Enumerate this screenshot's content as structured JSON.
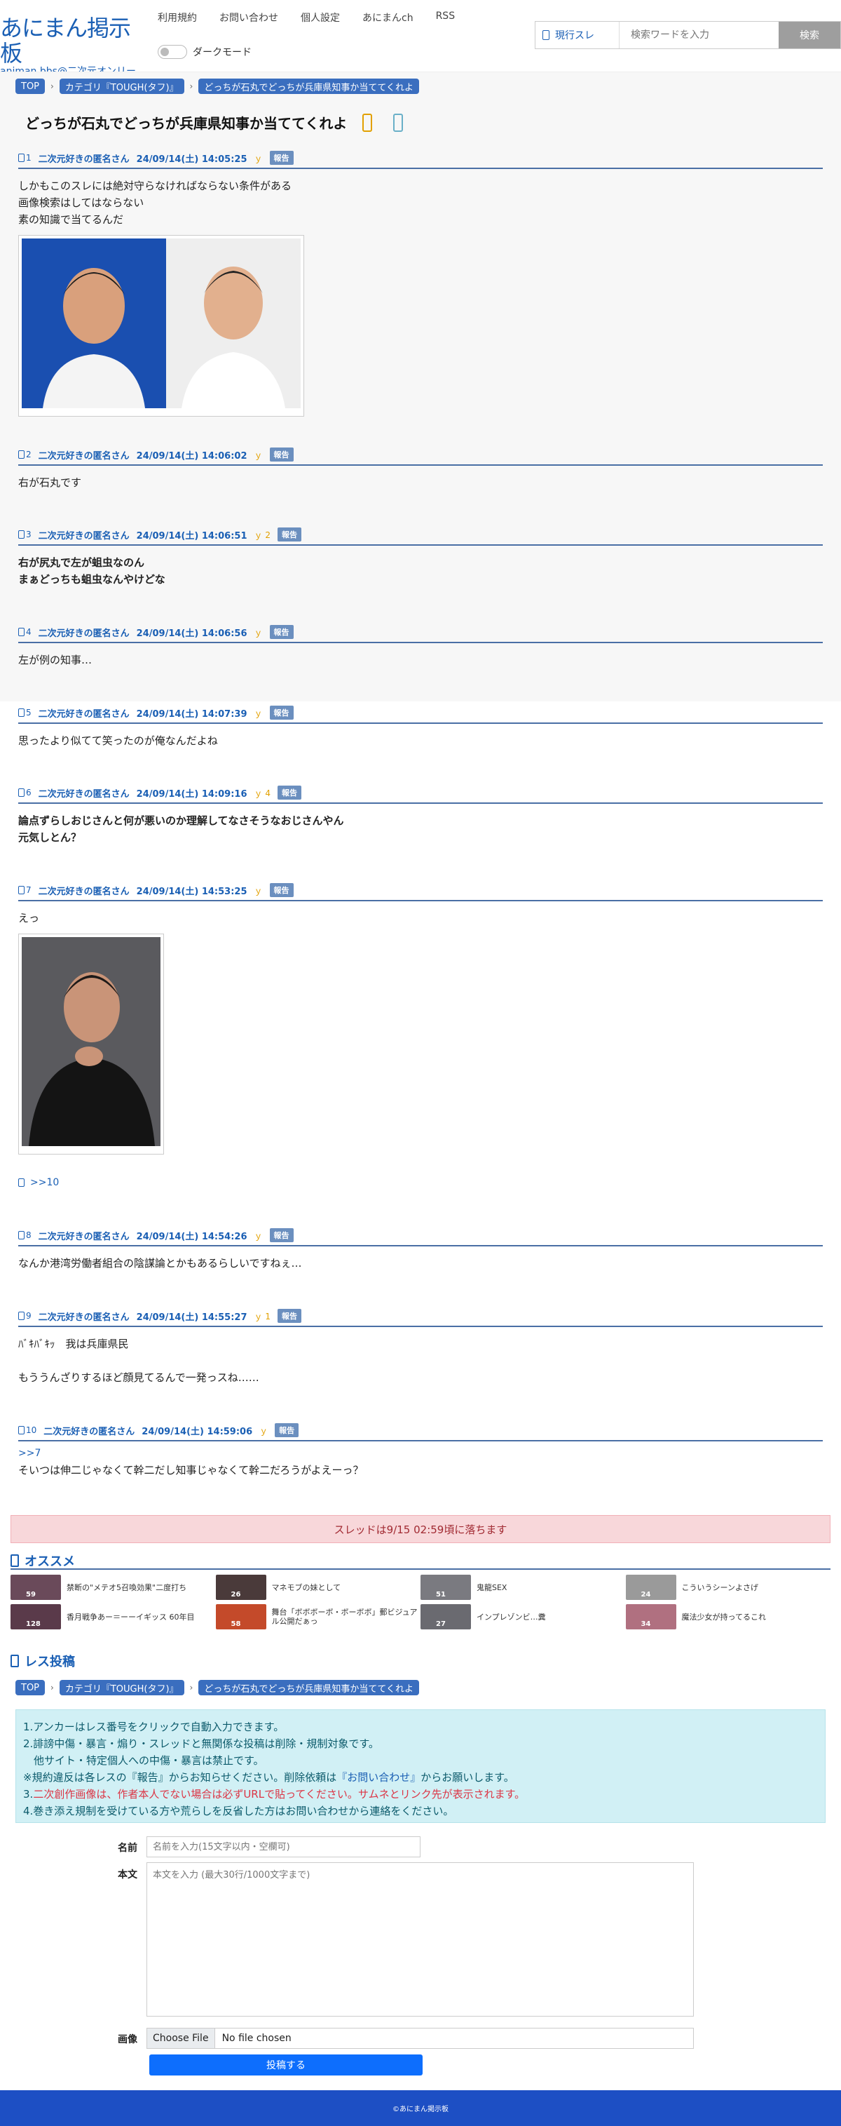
{
  "header": {
    "logo_main": "あにまん掲示板",
    "logo_sub": "animan bbs@二次元オンリー",
    "nav": [
      "利用規約",
      "お問い合わせ",
      "個人設定",
      "あにまんch",
      "RSS"
    ],
    "darkmode_label": "ダークモード",
    "search": {
      "scope": "現行スレ",
      "placeholder": "検索ワードを入力",
      "button": "検索"
    }
  },
  "breadcrumb": {
    "top": "TOP",
    "category": "カテゴリ『TOUGH(タフ)』",
    "thread": "どっちが石丸でどっちが兵庫県知事か当ててくれよ"
  },
  "thread": {
    "title": "どっちが石丸でどっちが兵庫県知事か当ててくれよ"
  },
  "posts": [
    {
      "num": "1",
      "name": "二次元好きの匿名さん",
      "date": "24/09/14(土) 14:05:25",
      "good": "",
      "report": "報告",
      "lines": [
        "しかもこのスレには絶対守らなければならない条件がある",
        "画像検索はしてはならない",
        "素の知識で当てるんだ"
      ]
    },
    {
      "num": "2",
      "name": "二次元好きの匿名さん",
      "date": "24/09/14(土) 14:06:02",
      "good": "",
      "report": "報告",
      "lines": [
        "右が石丸です"
      ]
    },
    {
      "num": "3",
      "name": "二次元好きの匿名さん",
      "date": "24/09/14(土) 14:06:51",
      "good": "2",
      "report": "報告",
      "lines": [
        "右が尻丸で左が蛆虫なのん",
        "まぁどっちも蛆虫なんやけどな"
      ]
    },
    {
      "num": "4",
      "name": "二次元好きの匿名さん",
      "date": "24/09/14(土) 14:06:56",
      "good": "",
      "report": "報告",
      "lines": [
        "左が例の知事…"
      ]
    },
    {
      "num": "5",
      "name": "二次元好きの匿名さん",
      "date": "24/09/14(土) 14:07:39",
      "good": "",
      "report": "報告",
      "lines": [
        "思ったより似てて笑ったのが俺なんだよね"
      ]
    },
    {
      "num": "6",
      "name": "二次元好きの匿名さん",
      "date": "24/09/14(土) 14:09:16",
      "good": "4",
      "report": "報告",
      "lines": [
        "論点ずらしおじさんと何が悪いのか理解してなさそうなおじさんやん",
        "元気しとん？"
      ]
    },
    {
      "num": "7",
      "name": "二次元好きの匿名さん",
      "date": "24/09/14(土) 14:53:25",
      "good": "",
      "report": "報告",
      "lines": [
        "えっ"
      ],
      "reply": ">>10"
    },
    {
      "num": "8",
      "name": "二次元好きの匿名さん",
      "date": "24/09/14(土) 14:54:26",
      "good": "",
      "report": "報告",
      "lines": [
        "なんか港湾労働者組合の陰謀論とかもあるらしいですねぇ…"
      ]
    },
    {
      "num": "9",
      "name": "二次元好きの匿名さん",
      "date": "24/09/14(土) 14:55:27",
      "good": "1",
      "report": "報告",
      "lines": [
        "ﾊﾞｷﾊﾞｷｯ　我は兵庫県民",
        "",
        "もううんざりするほど顔見てるんで一発っスね……"
      ]
    },
    {
      "num": "10",
      "name": "二次元好きの匿名さん",
      "date": "24/09/14(土) 14:59:06",
      "good": "",
      "report": "報告",
      "anchor": ">>7",
      "lines": [
        "そいつは伸二じゃなくて幹二だし知事じゃなくて幹二だろうがよえーっ？"
      ]
    }
  ],
  "drop_notice": "スレッドは9/15 02:59頃に落ちます",
  "recommend": {
    "heading": "オススメ",
    "items": [
      {
        "title": "禁断の\"メテオ5召喚効果\"二度打ち",
        "count": "59",
        "color": "#6a4a5a"
      },
      {
        "title": "マネモブの妹として",
        "count": "26",
        "color": "#4a3a3a"
      },
      {
        "title": "鬼龍SEX",
        "count": "51",
        "color": "#7a7a80"
      },
      {
        "title": "こういうシーンよさげ",
        "count": "24",
        "color": "#9a9a9a"
      },
      {
        "title": "香月戦争あー＝ーーイギッス 60年目",
        "count": "128",
        "color": "#5a3a4a"
      },
      {
        "title": "舞台「ボボボーボ・ボーボボ」郵ビジュアル公開だぁっ",
        "count": "58",
        "color": "#c44a2a"
      },
      {
        "title": "インプレゾンビ…糞",
        "count": "27",
        "color": "#6a6a70"
      },
      {
        "title": "魔法少女が持ってるこれ",
        "count": "34",
        "color": "#b07080"
      }
    ]
  },
  "post_form": {
    "heading": "レス投稿",
    "notes": [
      "1.アンカーはレス番号をクリックで自動入力できます。",
      "2.誹謗中傷・暴言・煽り・スレッドと無関係な投稿は削除・規制対象です。",
      "　他サイト・特定個人への中傷・暴言は禁止です。",
      "※規約違反は各レスの『報告』からお知らせください。削除依頼は",
      "『お問い合わせ』",
      "からお願いします。",
      "3.",
      "二次創作画像は、作者本人でない場合は必ずURLで貼ってください。サムネとリンク先が表示されます。",
      "4.巻き添え規制を受けている方や荒らしを反省した方はお問い合わせから連絡をください。"
    ],
    "name_label": "名前",
    "name_placeholder": "名前を入力(15文字以内・空欄可)",
    "body_label": "本文",
    "body_placeholder": "本文を入力 (最大30行/1000文字まで)",
    "image_label": "画像",
    "file_button": "Choose File",
    "file_status": "No file chosen",
    "submit": "投稿する"
  },
  "footer": "©あにまん掲示板"
}
